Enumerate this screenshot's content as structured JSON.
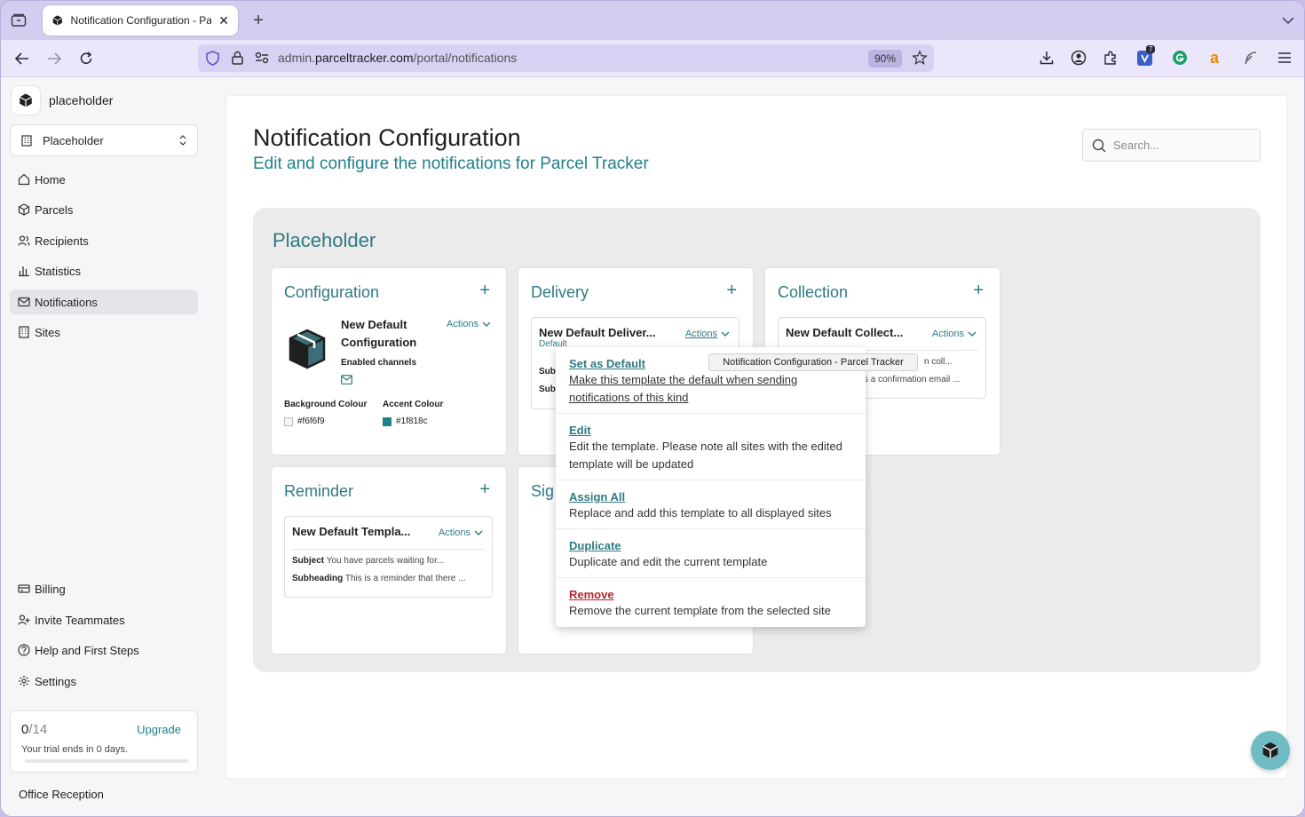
{
  "browser": {
    "tab_title": "Notification Configuration - Parcel Tracker",
    "url_domain": "admin.",
    "url_host": "parceltracker.com",
    "url_path": "/portal/notifications",
    "zoom": "90%",
    "extension_badge": "7"
  },
  "sidebar": {
    "org_name": "placeholder",
    "site_selector": "Placeholder",
    "nav": [
      {
        "label": "Home",
        "icon": "home-icon"
      },
      {
        "label": "Parcels",
        "icon": "parcel-icon"
      },
      {
        "label": "Recipients",
        "icon": "users-icon"
      },
      {
        "label": "Statistics",
        "icon": "chart-icon"
      },
      {
        "label": "Notifications",
        "icon": "mail-icon"
      },
      {
        "label": "Sites",
        "icon": "building-icon"
      }
    ],
    "bottom_nav": [
      {
        "label": "Billing",
        "icon": "billing-icon"
      },
      {
        "label": "Invite Teammates",
        "icon": "user-plus-icon"
      },
      {
        "label": "Help and First Steps",
        "icon": "help-icon"
      },
      {
        "label": "Settings",
        "icon": "gear-icon"
      }
    ],
    "trial": {
      "used": "0",
      "total": "/14",
      "upgrade": "Upgrade",
      "message": "Your trial ends in 0 days."
    },
    "office": "Office Reception"
  },
  "main": {
    "title": "Notification Configuration",
    "subtitle": "Edit and configure the notifications for Parcel Tracker",
    "search_placeholder": "Search...",
    "group_title": "Placeholder",
    "config_card": {
      "title": "Configuration",
      "name_line1": "New Default",
      "name_line2": "Configuration",
      "actions": "Actions",
      "channels_label": "Enabled channels",
      "bg_label": "Background Colour",
      "bg_value": "#f6f6f9",
      "accent_label": "Accent Colour",
      "accent_value": "#1f818c"
    },
    "delivery_card": {
      "title": "Delivery",
      "name": "New Default Deliver...",
      "badge": "Default",
      "actions": "Actions",
      "line1": "Sub",
      "line2": "Sub"
    },
    "collection_card": {
      "title": "Collection",
      "name": "New Default Collect...",
      "actions": "Actions",
      "line1": "n coll...",
      "line2": "s a confirmation email ..."
    },
    "reminder_card": {
      "title": "Reminder",
      "name": "New Default Templa...",
      "actions": "Actions",
      "subject_label": "Subject",
      "subject_value": "You have parcels waiting for...",
      "subheading_label": "Subheading",
      "subheading_value": "This is a reminder that there ..."
    },
    "signature_card": {
      "title": "Sig"
    }
  },
  "menu": [
    {
      "title": "Set as Default",
      "desc": "Make this template the default when sending notifications of this kind"
    },
    {
      "title": "Edit",
      "desc": "Edit the template. Please note all sites with the edited template will be updated"
    },
    {
      "title": "Assign All",
      "desc": "Replace and add this template to all displayed sites"
    },
    {
      "title": "Duplicate",
      "desc": "Duplicate and edit the current template"
    },
    {
      "title": "Remove",
      "desc": "Remove the current template from the selected site"
    }
  ],
  "tooltip": "Notification Configuration - Parcel Tracker",
  "colors": {
    "accent": "#1f818c",
    "background": "#f6f6f9",
    "danger": "#b3262b"
  }
}
